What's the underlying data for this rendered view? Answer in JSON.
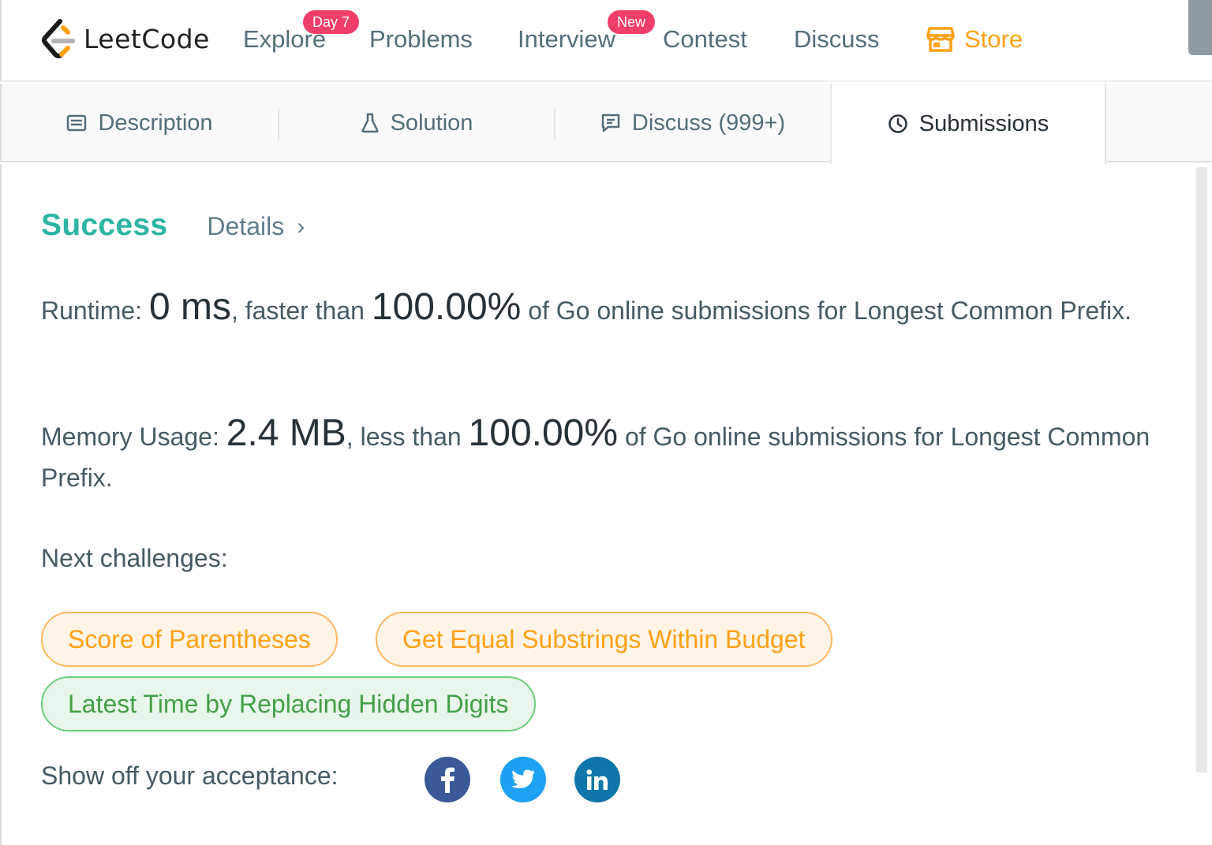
{
  "navbar": {
    "logo_text": "LeetCode",
    "items": [
      {
        "label": "Explore",
        "badge": "Day 7"
      },
      {
        "label": "Problems"
      },
      {
        "label": "Interview",
        "badge": "New"
      },
      {
        "label": "Contest"
      },
      {
        "label": "Discuss"
      },
      {
        "label": "Store",
        "icon": "store-icon"
      }
    ],
    "colors": {
      "accent": "#ffa116",
      "badge": "#f03e6b"
    }
  },
  "tabs": [
    {
      "label": "Description",
      "icon": "description-icon"
    },
    {
      "label": "Solution",
      "icon": "flask-icon"
    },
    {
      "label": "Discuss (999+)",
      "icon": "comment-icon"
    },
    {
      "label": "Submissions",
      "icon": "clock-icon",
      "active": true
    }
  ],
  "result": {
    "status": "Success",
    "status_color": "#2db5a3",
    "details_label": "Details",
    "runtime": {
      "label": "Runtime:",
      "value": "0 ms",
      "comparison": ", faster than",
      "percent": "100.00%",
      "suffix": "of Go online submissions for Longest Common Prefix."
    },
    "memory": {
      "label": "Memory Usage:",
      "value": "2.4 MB",
      "comparison": ", less than",
      "percent": "100.00%",
      "suffix": "of Go online submissions for Longest Common Prefix."
    }
  },
  "next_challenges": {
    "label": "Next challenges:",
    "items": [
      {
        "label": "Score of Parentheses",
        "difficulty": "medium"
      },
      {
        "label": "Get Equal Substrings Within Budget",
        "difficulty": "medium"
      },
      {
        "label": "Latest Time by Replacing Hidden Digits",
        "difficulty": "easy"
      }
    ]
  },
  "share": {
    "label": "Show off your acceptance:",
    "networks": [
      "facebook-icon",
      "twitter-icon",
      "linkedin-icon"
    ]
  }
}
